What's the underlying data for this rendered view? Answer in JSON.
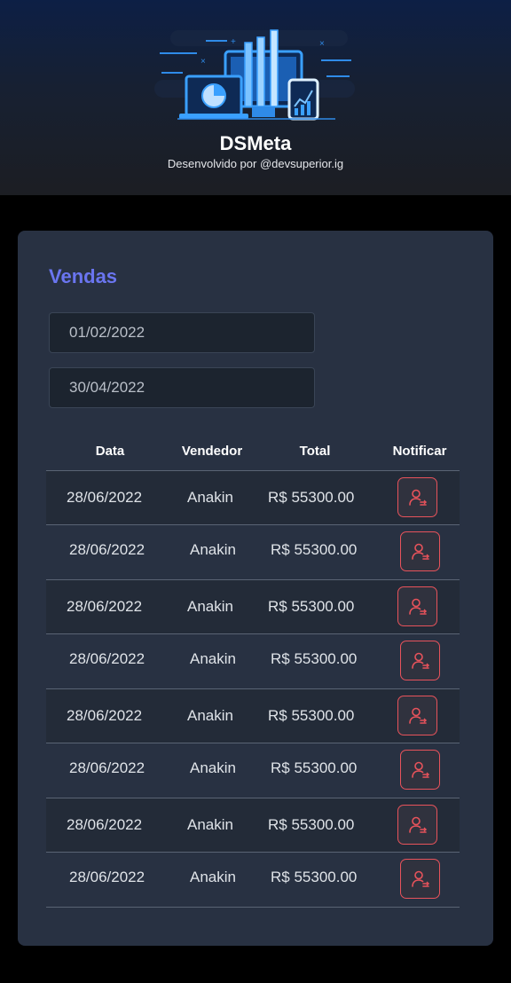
{
  "header": {
    "title": "DSMeta",
    "subtitle": "Desenvolvido por @devsuperior.ig",
    "logo_icon": "dashboard-devices-illustration"
  },
  "sales_card": {
    "title": "Vendas",
    "date_start": "01/02/2022",
    "date_end": "30/04/2022",
    "columns": [
      "Data",
      "Vendedor",
      "Total",
      "Notificar"
    ],
    "rows": [
      {
        "date": "28/06/2022",
        "seller": "Anakin",
        "total": "R$ 55300.00"
      },
      {
        "date": "28/06/2022",
        "seller": "Anakin",
        "total": "R$ 55300.00"
      },
      {
        "date": "28/06/2022",
        "seller": "Anakin",
        "total": "R$ 55300.00"
      },
      {
        "date": "28/06/2022",
        "seller": "Anakin",
        "total": "R$ 55300.00"
      },
      {
        "date": "28/06/2022",
        "seller": "Anakin",
        "total": "R$ 55300.00"
      },
      {
        "date": "28/06/2022",
        "seller": "Anakin",
        "total": "R$ 55300.00"
      },
      {
        "date": "28/06/2022",
        "seller": "Anakin",
        "total": "R$ 55300.00"
      },
      {
        "date": "28/06/2022",
        "seller": "Anakin",
        "total": "R$ 55300.00"
      }
    ],
    "notify_icon": "notify-user-icon"
  },
  "colors": {
    "accent": "#6a75f0",
    "card": "#283142",
    "danger": "#e8535b",
    "background": "#000000"
  }
}
